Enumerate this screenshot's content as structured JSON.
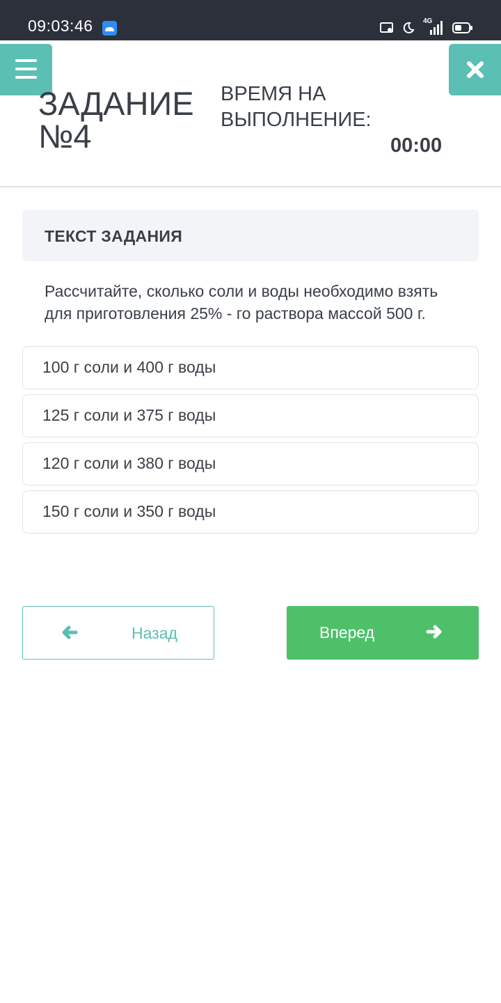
{
  "status_bar": {
    "time": "09:03:46",
    "network": "4G",
    "icons": [
      "android-app-icon",
      "cast-icon",
      "moon-icon",
      "signal-icon",
      "battery-icon"
    ]
  },
  "header": {
    "menu_icon": "hamburger-menu-icon",
    "close_icon": "close-icon",
    "task_title": "ЗАДАНИЕ №4",
    "time_label": "ВРЕМЯ НА ВЫПОЛНЕНИЕ:",
    "time_value": "00:00"
  },
  "task": {
    "heading": "ТЕКСТ ЗАДАНИЯ",
    "text": "Рассчитайте, сколько соли и воды необходимо взять для приготовления 25% - го раствора массой 500 г."
  },
  "answers": [
    "100 г соли и 400 г воды",
    "125 г соли и 375 г воды",
    "120 г соли и 380 г воды",
    "150 г соли и 350 г воды"
  ],
  "nav": {
    "back_label": "Назад",
    "next_label": "Вперед"
  },
  "colors": {
    "status_bar": "#2c303b",
    "accent_teal": "#5bbfb4",
    "next_green": "#4fc06a",
    "text": "#3a3f47",
    "task_box": "#f3f4f7"
  }
}
